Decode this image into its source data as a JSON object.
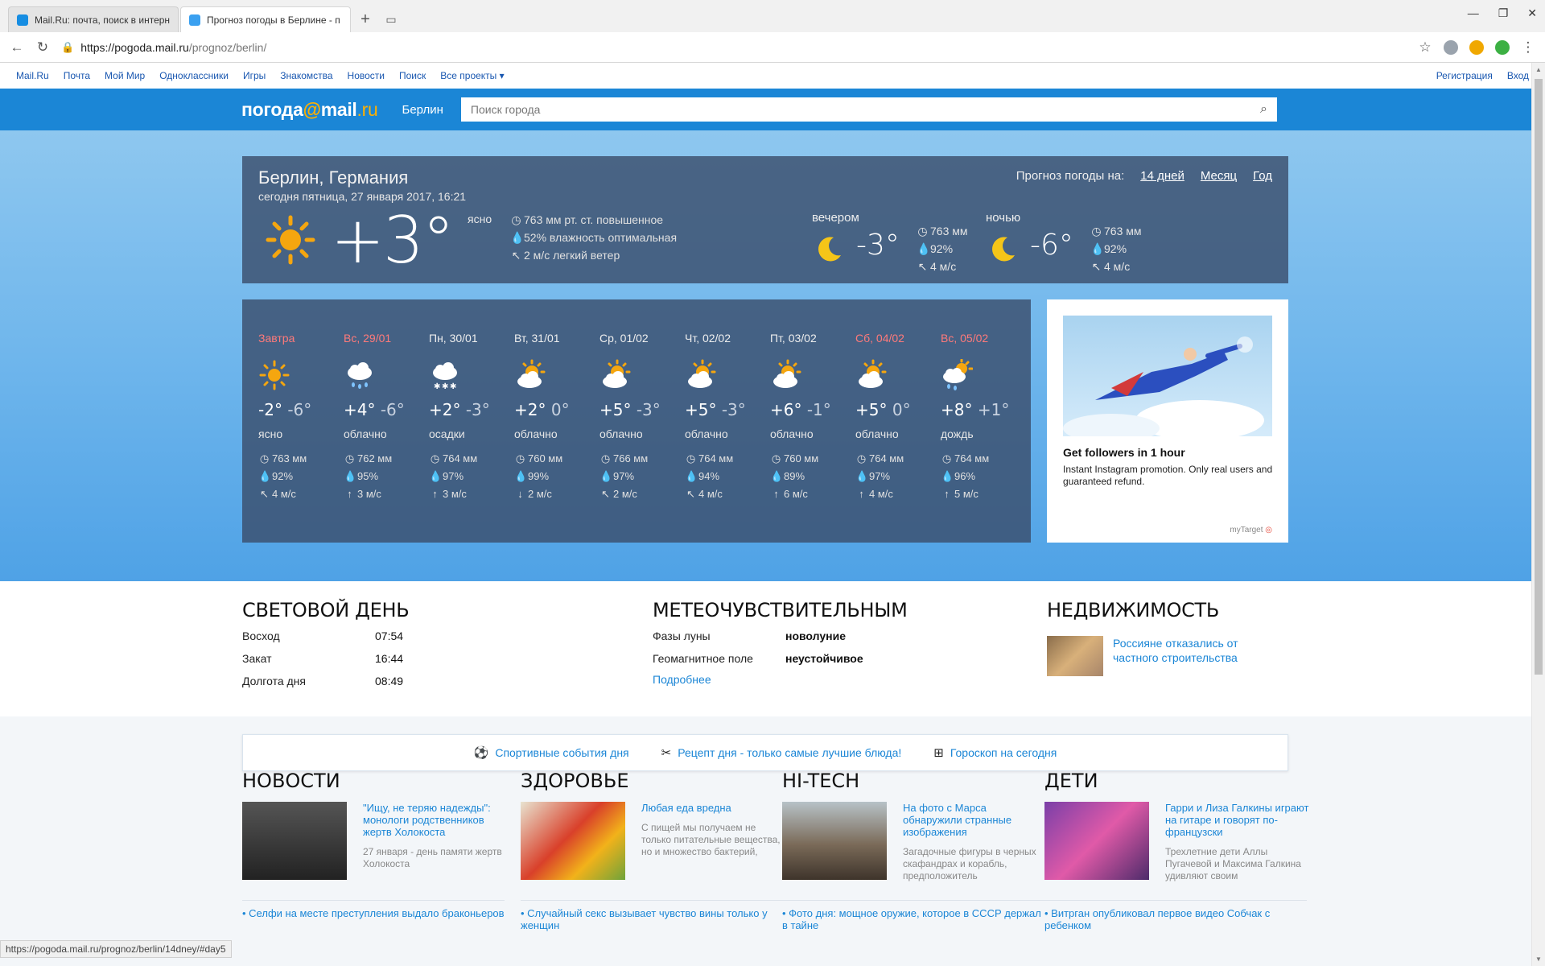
{
  "browser": {
    "tabs": [
      {
        "label": "Mail.Ru: почта, поиск в интерн",
        "active": false
      },
      {
        "label": "Прогноз погоды в Берлине - п",
        "active": true
      }
    ],
    "url_host": "https://pogoda.mail.ru",
    "url_path": "/prognoz/berlin/",
    "status_url": "https://pogoda.mail.ru/prognoz/berlin/14dney/#day5"
  },
  "portal": {
    "links": [
      "Mail.Ru",
      "Почта",
      "Мой Мир",
      "Одноклассники",
      "Игры",
      "Знакомства",
      "Новости",
      "Поиск",
      "Все проекты"
    ],
    "register": "Регистрация",
    "login": "Вход"
  },
  "header": {
    "logo_a": "погода",
    "logo_at": "@",
    "logo_b": "mail",
    "logo_ru": ".ru",
    "city": "Берлин",
    "search_placeholder": "Поиск города"
  },
  "current": {
    "title": "Берлин, Германия",
    "date": "сегодня пятница, 27 января 2017, 16:21",
    "forecast_label": "Прогноз погоды на:",
    "forecast_links": [
      "14 дней",
      "Месяц",
      "Год"
    ],
    "temp": "+3°",
    "desc": "ясно",
    "pressure": "763 мм рт. ст. повышенное",
    "humidity": "52% влажность оптимальная",
    "wind": "2 м/с легкий ветер",
    "parts": [
      {
        "label": "вечером",
        "temp": "-3°",
        "pressure": "763 мм",
        "humidity": "92%",
        "wind": "4 м/с"
      },
      {
        "label": "ночью",
        "temp": "-6°",
        "pressure": "763 мм",
        "humidity": "92%",
        "wind": "4 м/с"
      }
    ]
  },
  "days": [
    {
      "name": "Завтра",
      "weekend": true,
      "icon": "sun",
      "tmax": "-2°",
      "tmin": "-6°",
      "desc": "ясно",
      "pressure": "763 мм",
      "humidity": "92%",
      "wind_arrow": "↖",
      "wind": "4 м/с"
    },
    {
      "name": "Вс, 29/01",
      "weekend": true,
      "icon": "rain",
      "tmax": "+4°",
      "tmin": "-6°",
      "desc": "облачно",
      "pressure": "762 мм",
      "humidity": "95%",
      "wind_arrow": "↑",
      "wind": "3 м/с"
    },
    {
      "name": "Пн, 30/01",
      "weekend": false,
      "icon": "snow",
      "tmax": "+2°",
      "tmin": "-3°",
      "desc": "осадки",
      "pressure": "764 мм",
      "humidity": "97%",
      "wind_arrow": "↑",
      "wind": "3 м/с"
    },
    {
      "name": "Вт, 31/01",
      "weekend": false,
      "icon": "partly",
      "tmax": "+2°",
      "tmin": "0°",
      "desc": "облачно",
      "pressure": "760 мм",
      "humidity": "99%",
      "wind_arrow": "↓",
      "wind": "2 м/с"
    },
    {
      "name": "Ср, 01/02",
      "weekend": false,
      "icon": "partly",
      "tmax": "+5°",
      "tmin": "-3°",
      "desc": "облачно",
      "pressure": "766 мм",
      "humidity": "97%",
      "wind_arrow": "↖",
      "wind": "2 м/с"
    },
    {
      "name": "Чт, 02/02",
      "weekend": false,
      "icon": "partly",
      "tmax": "+5°",
      "tmin": "-3°",
      "desc": "облачно",
      "pressure": "764 мм",
      "humidity": "94%",
      "wind_arrow": "↖",
      "wind": "4 м/с"
    },
    {
      "name": "Пт, 03/02",
      "weekend": false,
      "icon": "partly",
      "tmax": "+6°",
      "tmin": "-1°",
      "desc": "облачно",
      "pressure": "760 мм",
      "humidity": "89%",
      "wind_arrow": "↑",
      "wind": "6 м/с"
    },
    {
      "name": "Сб, 04/02",
      "weekend": true,
      "icon": "partly",
      "tmax": "+5°",
      "tmin": "0°",
      "desc": "облачно",
      "pressure": "764 мм",
      "humidity": "97%",
      "wind_arrow": "↑",
      "wind": "4 м/с"
    },
    {
      "name": "Вс, 05/02",
      "weekend": true,
      "icon": "sunrain",
      "tmax": "+8°",
      "tmin": "+1°",
      "desc": "дождь",
      "pressure": "764 мм",
      "humidity": "96%",
      "wind_arrow": "↑",
      "wind": "5 м/с"
    }
  ],
  "ad": {
    "title": "Get followers in 1 hour",
    "text": "Instant Instagram promotion. Only real users and guaranteed refund.",
    "brand": "myTarget"
  },
  "daylight": {
    "title": "СВЕТОВОЙ ДЕНЬ",
    "rows": [
      {
        "k": "Восход",
        "v": "07:54"
      },
      {
        "k": "Закат",
        "v": "16:44"
      },
      {
        "k": "Долгота дня",
        "v": "08:49"
      }
    ]
  },
  "meteo": {
    "title": "МЕТЕОЧУВСТВИТЕЛЬНЫМ",
    "rows": [
      {
        "k": "Фазы луны",
        "v": "новолуние"
      },
      {
        "k": "Геомагнитное поле",
        "v": "неустойчивое"
      }
    ],
    "more": "Подробнее"
  },
  "estate": {
    "title": "НЕДВИЖИМОСТЬ",
    "item": "Россияне отказались от частного строительства"
  },
  "linksbar": [
    "Спортивные события дня",
    "Рецепт дня - только самые лучшие блюда!",
    "Гороскоп на сегодня"
  ],
  "news": [
    {
      "title": "НОВОСТИ",
      "item_title": "\"Ищу, не теряю надежды\": монологи родственников жертв Холокоста",
      "item_text": "27 января - день памяти жертв Холокоста",
      "foot": "Селфи на месте преступления выдало браконьеров"
    },
    {
      "title": "ЗДОРОВЬЕ",
      "item_title": "Любая еда вредна",
      "item_text": "С пищей мы получаем не только питательные вещества, но и множество бактерий, которые запускают есте",
      "foot": "Случайный секс вызывает чувство вины только у женщин"
    },
    {
      "title": "HI-TECH",
      "item_title": "На фото с Марса обнаружили странные изображения",
      "item_text": "Загадочные фигуры в черных скафандрах и корабль, предположитель",
      "foot": "Фото дня: мощное оружие, которое в СССР держал в тайне"
    },
    {
      "title": "ДЕТИ",
      "item_title": "Гарри и Лиза Галкины играют на гитаре и говорят по-французски",
      "item_text": "Трехлетние дети Аллы Пугачевой и Максима Галкина удивляют своим",
      "foot": "Витрган опубликовал первое видео Собчак с ребенком"
    }
  ]
}
